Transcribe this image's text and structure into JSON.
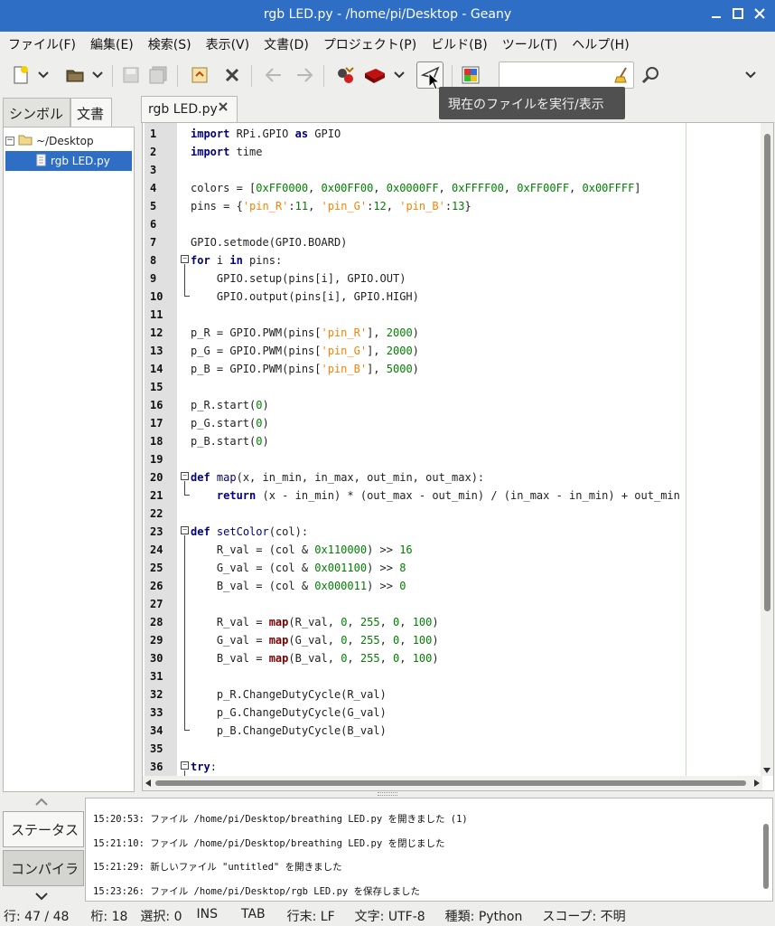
{
  "window": {
    "title": "rgb LED.py - /home/pi/Desktop - Geany"
  },
  "menu": [
    "ファイル(F)",
    "編集(E)",
    "検索(S)",
    "表示(V)",
    "文書(D)",
    "プロジェクト(P)",
    "ビルド(B)",
    "ツール(T)",
    "ヘルプ(H)"
  ],
  "toolbar": {
    "icons": [
      "new-file-icon",
      "open-file-icon",
      "save-icon",
      "save-all-icon",
      "revert-icon",
      "close-icon",
      "back-icon",
      "forward-icon",
      "compile-icon",
      "build-icon",
      "run-icon",
      "color-chooser-icon",
      "find-icon"
    ],
    "search_value": "",
    "tooltip": "現在のファイルを実行/表示"
  },
  "sidebar": {
    "tabs": [
      "シンボル",
      "文書"
    ],
    "active_tab": "文書",
    "tree": {
      "folder": "~/Desktop",
      "file": "rgb LED.py"
    }
  },
  "editor": {
    "tab_label": "rgb LED.py",
    "lines": [
      {
        "n": "1",
        "t": "import RPi.GPIO as GPIO"
      },
      {
        "n": "2",
        "t": "import time"
      },
      {
        "n": "3",
        "t": ""
      },
      {
        "n": "4",
        "t": "colors = [0xFF0000, 0x00FF00, 0x0000FF, 0xFFFF00, 0xFF00FF, 0x00FFFF]"
      },
      {
        "n": "5",
        "t": "pins = {'pin_R':11, 'pin_G':12, 'pin_B':13}"
      },
      {
        "n": "6",
        "t": ""
      },
      {
        "n": "7",
        "t": "GPIO.setmode(GPIO.BOARD)"
      },
      {
        "n": "8",
        "t": "for i in pins:"
      },
      {
        "n": "9",
        "t": "    GPIO.setup(pins[i], GPIO.OUT)"
      },
      {
        "n": "10",
        "t": "    GPIO.output(pins[i], GPIO.HIGH)"
      },
      {
        "n": "11",
        "t": ""
      },
      {
        "n": "12",
        "t": "p_R = GPIO.PWM(pins['pin_R'], 2000)"
      },
      {
        "n": "13",
        "t": "p_G = GPIO.PWM(pins['pin_G'], 2000)"
      },
      {
        "n": "14",
        "t": "p_B = GPIO.PWM(pins['pin_B'], 5000)"
      },
      {
        "n": "15",
        "t": ""
      },
      {
        "n": "16",
        "t": "p_R.start(0)"
      },
      {
        "n": "17",
        "t": "p_G.start(0)"
      },
      {
        "n": "18",
        "t": "p_B.start(0)"
      },
      {
        "n": "19",
        "t": ""
      },
      {
        "n": "20",
        "t": "def map(x, in_min, in_max, out_min, out_max):"
      },
      {
        "n": "21",
        "t": "    return (x - in_min) * (out_max - out_min) / (in_max - in_min) + out_min"
      },
      {
        "n": "22",
        "t": ""
      },
      {
        "n": "23",
        "t": "def setColor(col):"
      },
      {
        "n": "24",
        "t": "    R_val = (col & 0x110000) >> 16"
      },
      {
        "n": "25",
        "t": "    G_val = (col & 0x001100) >> 8"
      },
      {
        "n": "26",
        "t": "    B_val = (col & 0x000011) >> 0"
      },
      {
        "n": "27",
        "t": ""
      },
      {
        "n": "28",
        "t": "    R_val = map(R_val, 0, 255, 0, 100)"
      },
      {
        "n": "29",
        "t": "    G_val = map(G_val, 0, 255, 0, 100)"
      },
      {
        "n": "30",
        "t": "    B_val = map(B_val, 0, 255, 0, 100)"
      },
      {
        "n": "31",
        "t": ""
      },
      {
        "n": "32",
        "t": "    p_R.ChangeDutyCycle(R_val)"
      },
      {
        "n": "33",
        "t": "    p_G.ChangeDutyCycle(G_val)"
      },
      {
        "n": "34",
        "t": "    p_B.ChangeDutyCycle(B_val)"
      },
      {
        "n": "35",
        "t": ""
      },
      {
        "n": "36",
        "t": "try:"
      }
    ]
  },
  "messages": {
    "tabs": [
      "ステータス",
      "コンパイラ"
    ],
    "active_tab": "ステータス",
    "lines": [
      "15:20:53: ファイル /home/pi/Desktop/breathing LED.py を開きました (1)",
      "15:21:10: ファイル /home/pi/Desktop/breathing LED.py を閉じました",
      "15:21:29: 新しいファイル \"untitled\" を開きました",
      "15:23:26: ファイル /home/pi/Desktop/rgb LED.py を保存しました"
    ]
  },
  "status": {
    "line": "行: 47 / 48",
    "col": "桁: 18",
    "sel": "選択: 0",
    "mode": "INS",
    "indent": "TAB",
    "eol": "行末: LF",
    "encoding": "文字: UTF-8",
    "filetype": "種類: Python",
    "scope": "スコープ: 不明"
  },
  "colors": {
    "titlebar": "#2e6ec4",
    "selection": "#2e6ec4",
    "keyword": "#000080",
    "string": "#ff8000",
    "number": "#008000",
    "builtin": "#800000"
  }
}
